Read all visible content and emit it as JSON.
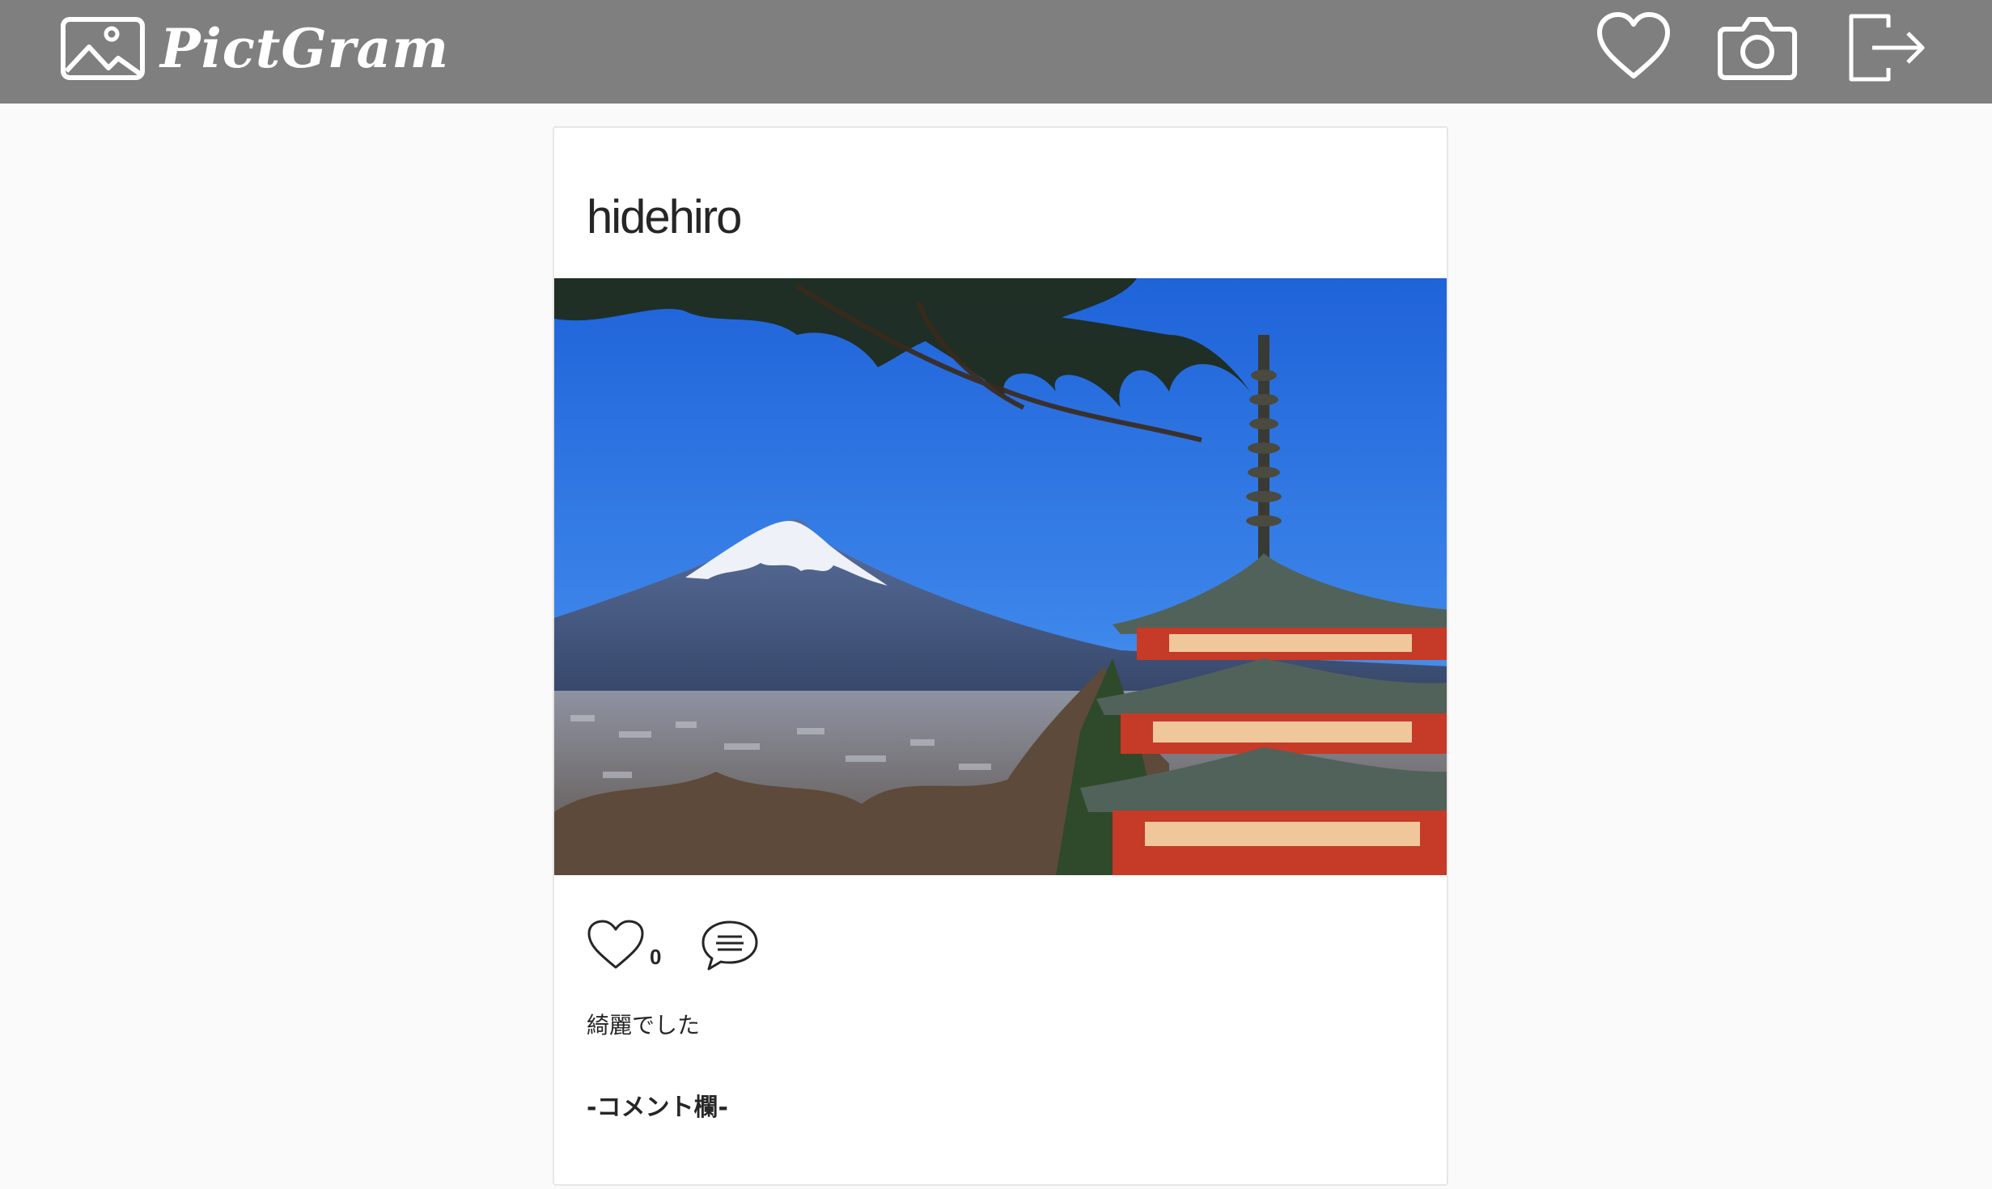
{
  "navbar": {
    "brand_name": "PictGram",
    "brand_icon": "image-icon",
    "icons": [
      "heart-icon",
      "camera-icon",
      "logout-icon"
    ],
    "background": "#7f7f7f"
  },
  "post": {
    "username": "hidehiro",
    "photo_icon": "photo-mount-fuji-pagoda",
    "likes_count": "0",
    "caption": "綺麗でした",
    "comment_heading": "-コメント欄-"
  }
}
